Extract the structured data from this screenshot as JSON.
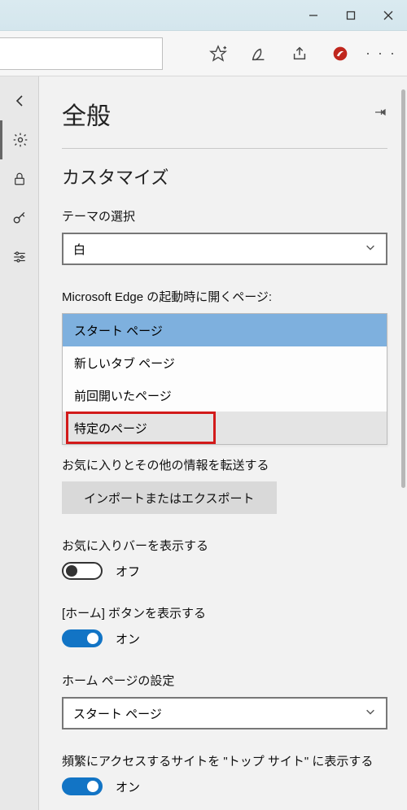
{
  "window": {
    "title": ""
  },
  "toolbar": {
    "icons": {
      "favorite": "favorite-star-icon",
      "notes": "notes-icon",
      "share": "share-icon",
      "trendmicro": "trend-micro-icon",
      "more": "more-icon"
    }
  },
  "sidebar": {
    "items": [
      "back",
      "settings",
      "lock",
      "key",
      "sliders"
    ]
  },
  "settings": {
    "title": "全般",
    "section_customize": "カスタマイズ",
    "theme": {
      "label": "テーマの選択",
      "value": "白"
    },
    "startup": {
      "label": "Microsoft Edge の起動時に開くページ:",
      "options": [
        "スタート ページ",
        "新しいタブ ページ",
        "前回開いたページ",
        "特定のページ"
      ],
      "selected_index": 0,
      "highlight_index": 3
    },
    "transfer": {
      "label": "お気に入りとその他の情報を転送する",
      "button": "インポートまたはエクスポート"
    },
    "favbar": {
      "label": "お気に入りバーを表示する",
      "value": false,
      "value_text": "オフ"
    },
    "homebutton": {
      "label": "[ホーム] ボタンを表示する",
      "value": true,
      "value_text": "オン"
    },
    "homepage": {
      "label": "ホーム ページの設定",
      "value": "スタート ページ"
    },
    "topsites": {
      "label": "頻繁にアクセスするサイトを \"トップ サイト\" に表示する",
      "value": true,
      "value_text": "オン"
    }
  }
}
